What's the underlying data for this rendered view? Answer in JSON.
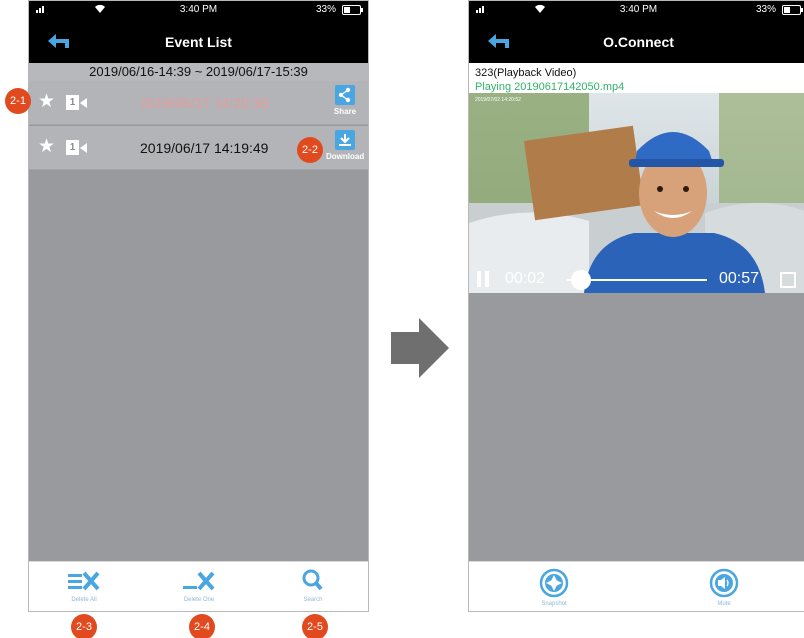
{
  "left_phone": {
    "status": {
      "time": "3:40 PM",
      "battery": "33%"
    },
    "title": "Event List",
    "date_range": "2019/06/16-14:39 ~ 2019/06/17-15:39",
    "events": [
      {
        "datetime": "2019/06/17  14:20:30",
        "selected": true,
        "action_label": "Share",
        "action_icon": "share-icon"
      },
      {
        "datetime": "2019/06/17  14:19:49",
        "selected": false,
        "action_label": "Download",
        "action_icon": "download-icon"
      }
    ],
    "event_camera_number": "1",
    "toolbar": {
      "delete_all": "Delete All",
      "delete_one": "Delete One",
      "search": "Search"
    }
  },
  "badges": {
    "row_star": "2-1",
    "download": "2-2",
    "delete_all": "2-3",
    "delete_one": "2-4",
    "search": "2-5"
  },
  "right_phone": {
    "status": {
      "time": "3:40 PM",
      "battery": "33%"
    },
    "title": "O.Connect",
    "video_title": "323(Playback Video)",
    "playing_file": "Playing 20190617142050.mp4",
    "video_timestamp": "2019/07/02 14:20:52",
    "current_time": "00:02",
    "duration": "00:57",
    "progress_fraction": 0.03,
    "toolbar": {
      "snapshot": "Snapshot",
      "mute": "Mute"
    }
  },
  "colors": {
    "accent": "#4aa6e0",
    "badge": "#e04a1e",
    "playing_text": "#31b36b",
    "selected_text": "#e99a9c"
  }
}
